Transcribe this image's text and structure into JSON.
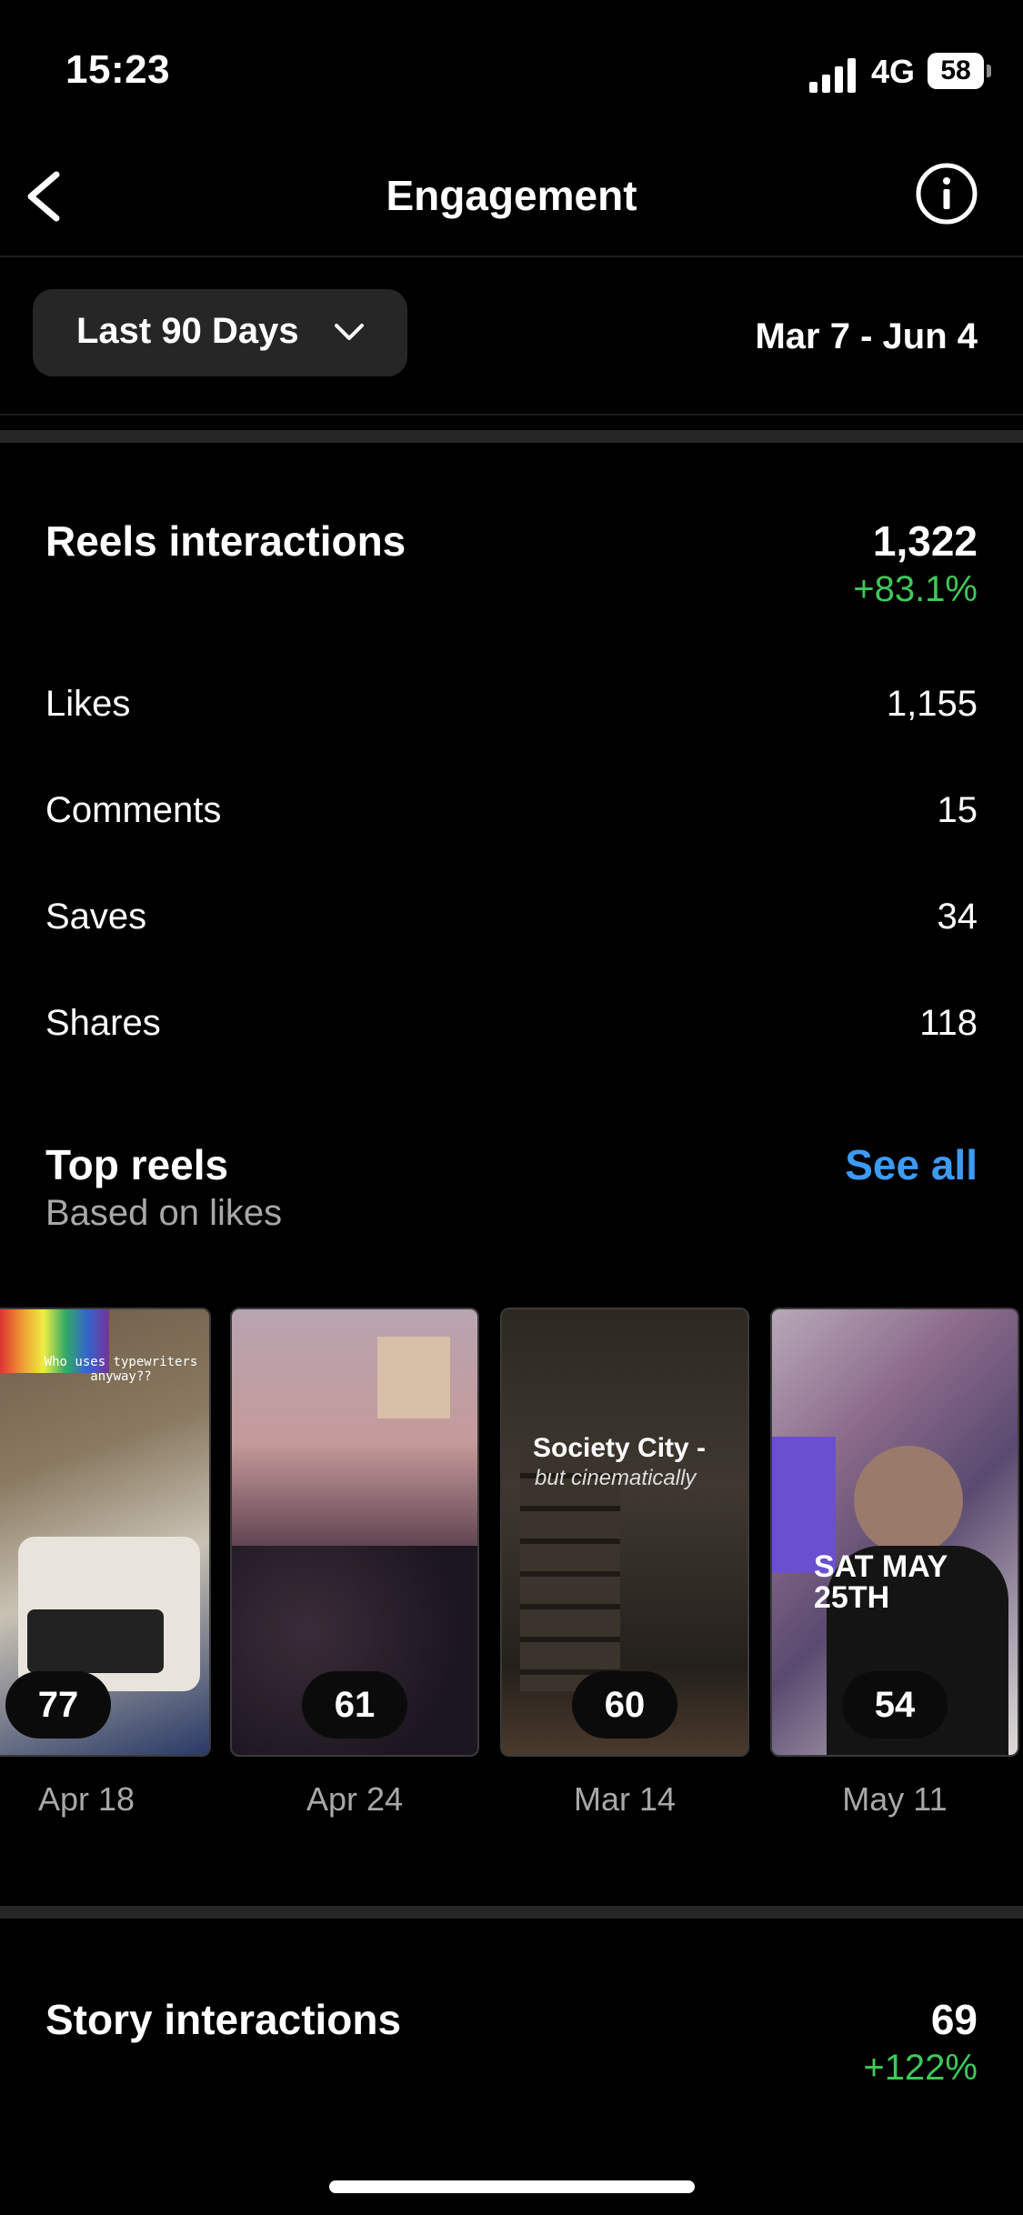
{
  "status_bar": {
    "time": "15:23",
    "network": "4G",
    "battery": "58"
  },
  "nav": {
    "title": "Engagement"
  },
  "filter": {
    "label": "Last 90 Days",
    "date_range": "Mar 7 - Jun 4"
  },
  "reels_interactions": {
    "title": "Reels interactions",
    "total": "1,322",
    "change": "+83.1%",
    "rows": [
      {
        "label": "Likes",
        "value": "1,155"
      },
      {
        "label": "Comments",
        "value": "15"
      },
      {
        "label": "Saves",
        "value": "34"
      },
      {
        "label": "Shares",
        "value": "118"
      }
    ]
  },
  "top_reels": {
    "title": "Top reels",
    "subtitle": "Based on likes",
    "see_all": "See all",
    "items": [
      {
        "count": "77",
        "date": "Apr 18",
        "caption": "Who uses typewriters anyway??"
      },
      {
        "count": "61",
        "date": "Apr 24"
      },
      {
        "count": "60",
        "date": "Mar 14",
        "caption": "Society City -",
        "caption2": "but cinematically"
      },
      {
        "count": "54",
        "date": "May 11",
        "caption": "SAT MAY 25TH"
      }
    ]
  },
  "story_interactions": {
    "title": "Story interactions",
    "total": "69",
    "change": "+122%"
  }
}
